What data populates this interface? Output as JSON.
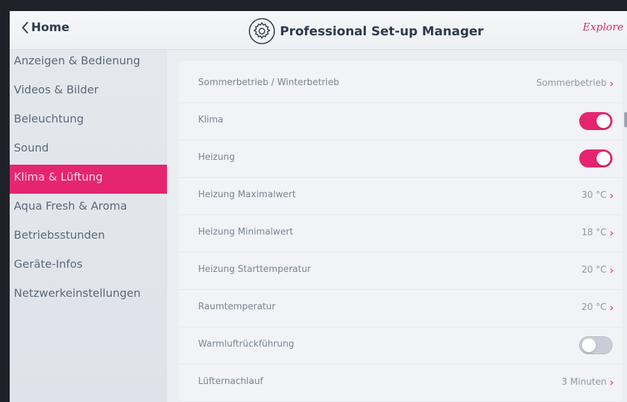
{
  "header": {
    "back_label": "Home",
    "title": "Professional Set-up Manager",
    "brand": "Explorer"
  },
  "sidebar": {
    "active_index": 4,
    "items": [
      {
        "label": "Anzeigen & Bedienung"
      },
      {
        "label": "Videos & Bilder"
      },
      {
        "label": "Beleuchtung"
      },
      {
        "label": "Sound"
      },
      {
        "label": "Klima & Lüftung"
      },
      {
        "label": "Aqua Fresh & Aroma"
      },
      {
        "label": "Betriebsstunden"
      },
      {
        "label": "Geräte-Infos"
      },
      {
        "label": "Netzwerkeinstellungen"
      }
    ]
  },
  "settings": [
    {
      "label": "Sommerbetrieb / Winterbetrieb",
      "value": "Sommerbetrieb"
    },
    {
      "label": "Klima",
      "toggle": true
    },
    {
      "label": "Heizung",
      "toggle": true
    },
    {
      "label": "Heizung Maximalwert",
      "value": "30 °C"
    },
    {
      "label": "Heizung Minimalwert",
      "value": "18 °C"
    },
    {
      "label": "Heizung Starttemperatur",
      "value": "20 °C"
    },
    {
      "label": "Raumtemperatur",
      "value": "20 °C"
    },
    {
      "label": "Warmluftrückführung",
      "toggle": false
    },
    {
      "label": "Lüfternachlauf",
      "value": "3 Minuten"
    }
  ],
  "colors": {
    "accent": "#e5256f",
    "header_text": "#2e3a4e"
  },
  "icons": {
    "back": "chevron-left-icon",
    "title": "gear-icon",
    "row_value": "chevron-right-icon"
  }
}
